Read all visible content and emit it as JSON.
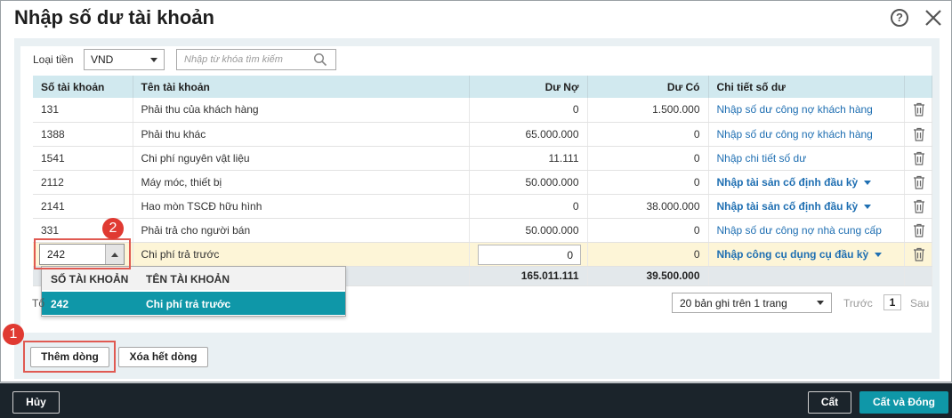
{
  "dialog": {
    "title": "Nhập số dư tài khoản",
    "help_symbol": "?"
  },
  "filters": {
    "currency_label": "Loại tiền",
    "currency_value": "VND",
    "search_placeholder": "Nhập từ khóa tìm kiếm"
  },
  "table": {
    "headers": {
      "account_no": "Số tài khoản",
      "account_name": "Tên tài khoản",
      "debit": "Dư Nợ",
      "credit": "Dư Có",
      "detail": "Chi tiết số dư"
    },
    "rows": [
      {
        "account_no": "131",
        "account_name": "Phải thu của khách hàng",
        "debit": "0",
        "credit": "1.500.000",
        "detail": "Nhập số dư công nợ khách hàng"
      },
      {
        "account_no": "1388",
        "account_name": "Phải thu khác",
        "debit": "65.000.000",
        "credit": "0",
        "detail": "Nhập số dư công nợ khách hàng"
      },
      {
        "account_no": "1541",
        "account_name": "Chi phí nguyên vật liệu",
        "debit": "11.111",
        "credit": "0",
        "detail": "Nhập chi tiết số dư"
      },
      {
        "account_no": "2112",
        "account_name": "Máy móc, thiết bị",
        "debit": "50.000.000",
        "credit": "0",
        "detail": "Nhập tài sản cố định đầu kỳ"
      },
      {
        "account_no": "2141",
        "account_name": "Hao mòn TSCĐ hữu hình",
        "debit": "0",
        "credit": "38.000.000",
        "detail": "Nhập tài sản cố định đầu kỳ"
      },
      {
        "account_no": "331",
        "account_name": "Phải trả cho người bán",
        "debit": "50.000.000",
        "credit": "0",
        "detail": "Nhập số dư công nợ nhà cung cấp"
      }
    ],
    "active_row": {
      "account_no": "242",
      "account_name": "Chi phí trả trước",
      "debit": "0",
      "credit": "0",
      "detail": "Nhập công cụ dụng cụ đầu kỳ"
    },
    "totals": {
      "debit": "165.011.111",
      "credit": "39.500.000"
    }
  },
  "dropdown": {
    "header_no": "SỐ TÀI KHOẢN",
    "header_name": "TÊN TÀI KHOẢN",
    "option_no": "242",
    "option_name": "Chi phí trả trước"
  },
  "partial_text": "Tổ",
  "pager": {
    "page_size": "20 bản ghi trên 1 trang",
    "prev": "Trước",
    "page": "1",
    "next": "Sau"
  },
  "buttons": {
    "add_row": "Thêm dòng",
    "clear_rows": "Xóa hết dòng"
  },
  "markers": {
    "one": "1",
    "two": "2"
  },
  "footer": {
    "cancel": "Hủy",
    "save": "Cất",
    "save_close": "Cất và Đóng"
  },
  "colors": {
    "accent": "#0f97a8",
    "link": "#1f6fb2",
    "header_bg": "#d1e9ef",
    "marker": "#e03a32",
    "footer_bg": "#1b242b"
  }
}
